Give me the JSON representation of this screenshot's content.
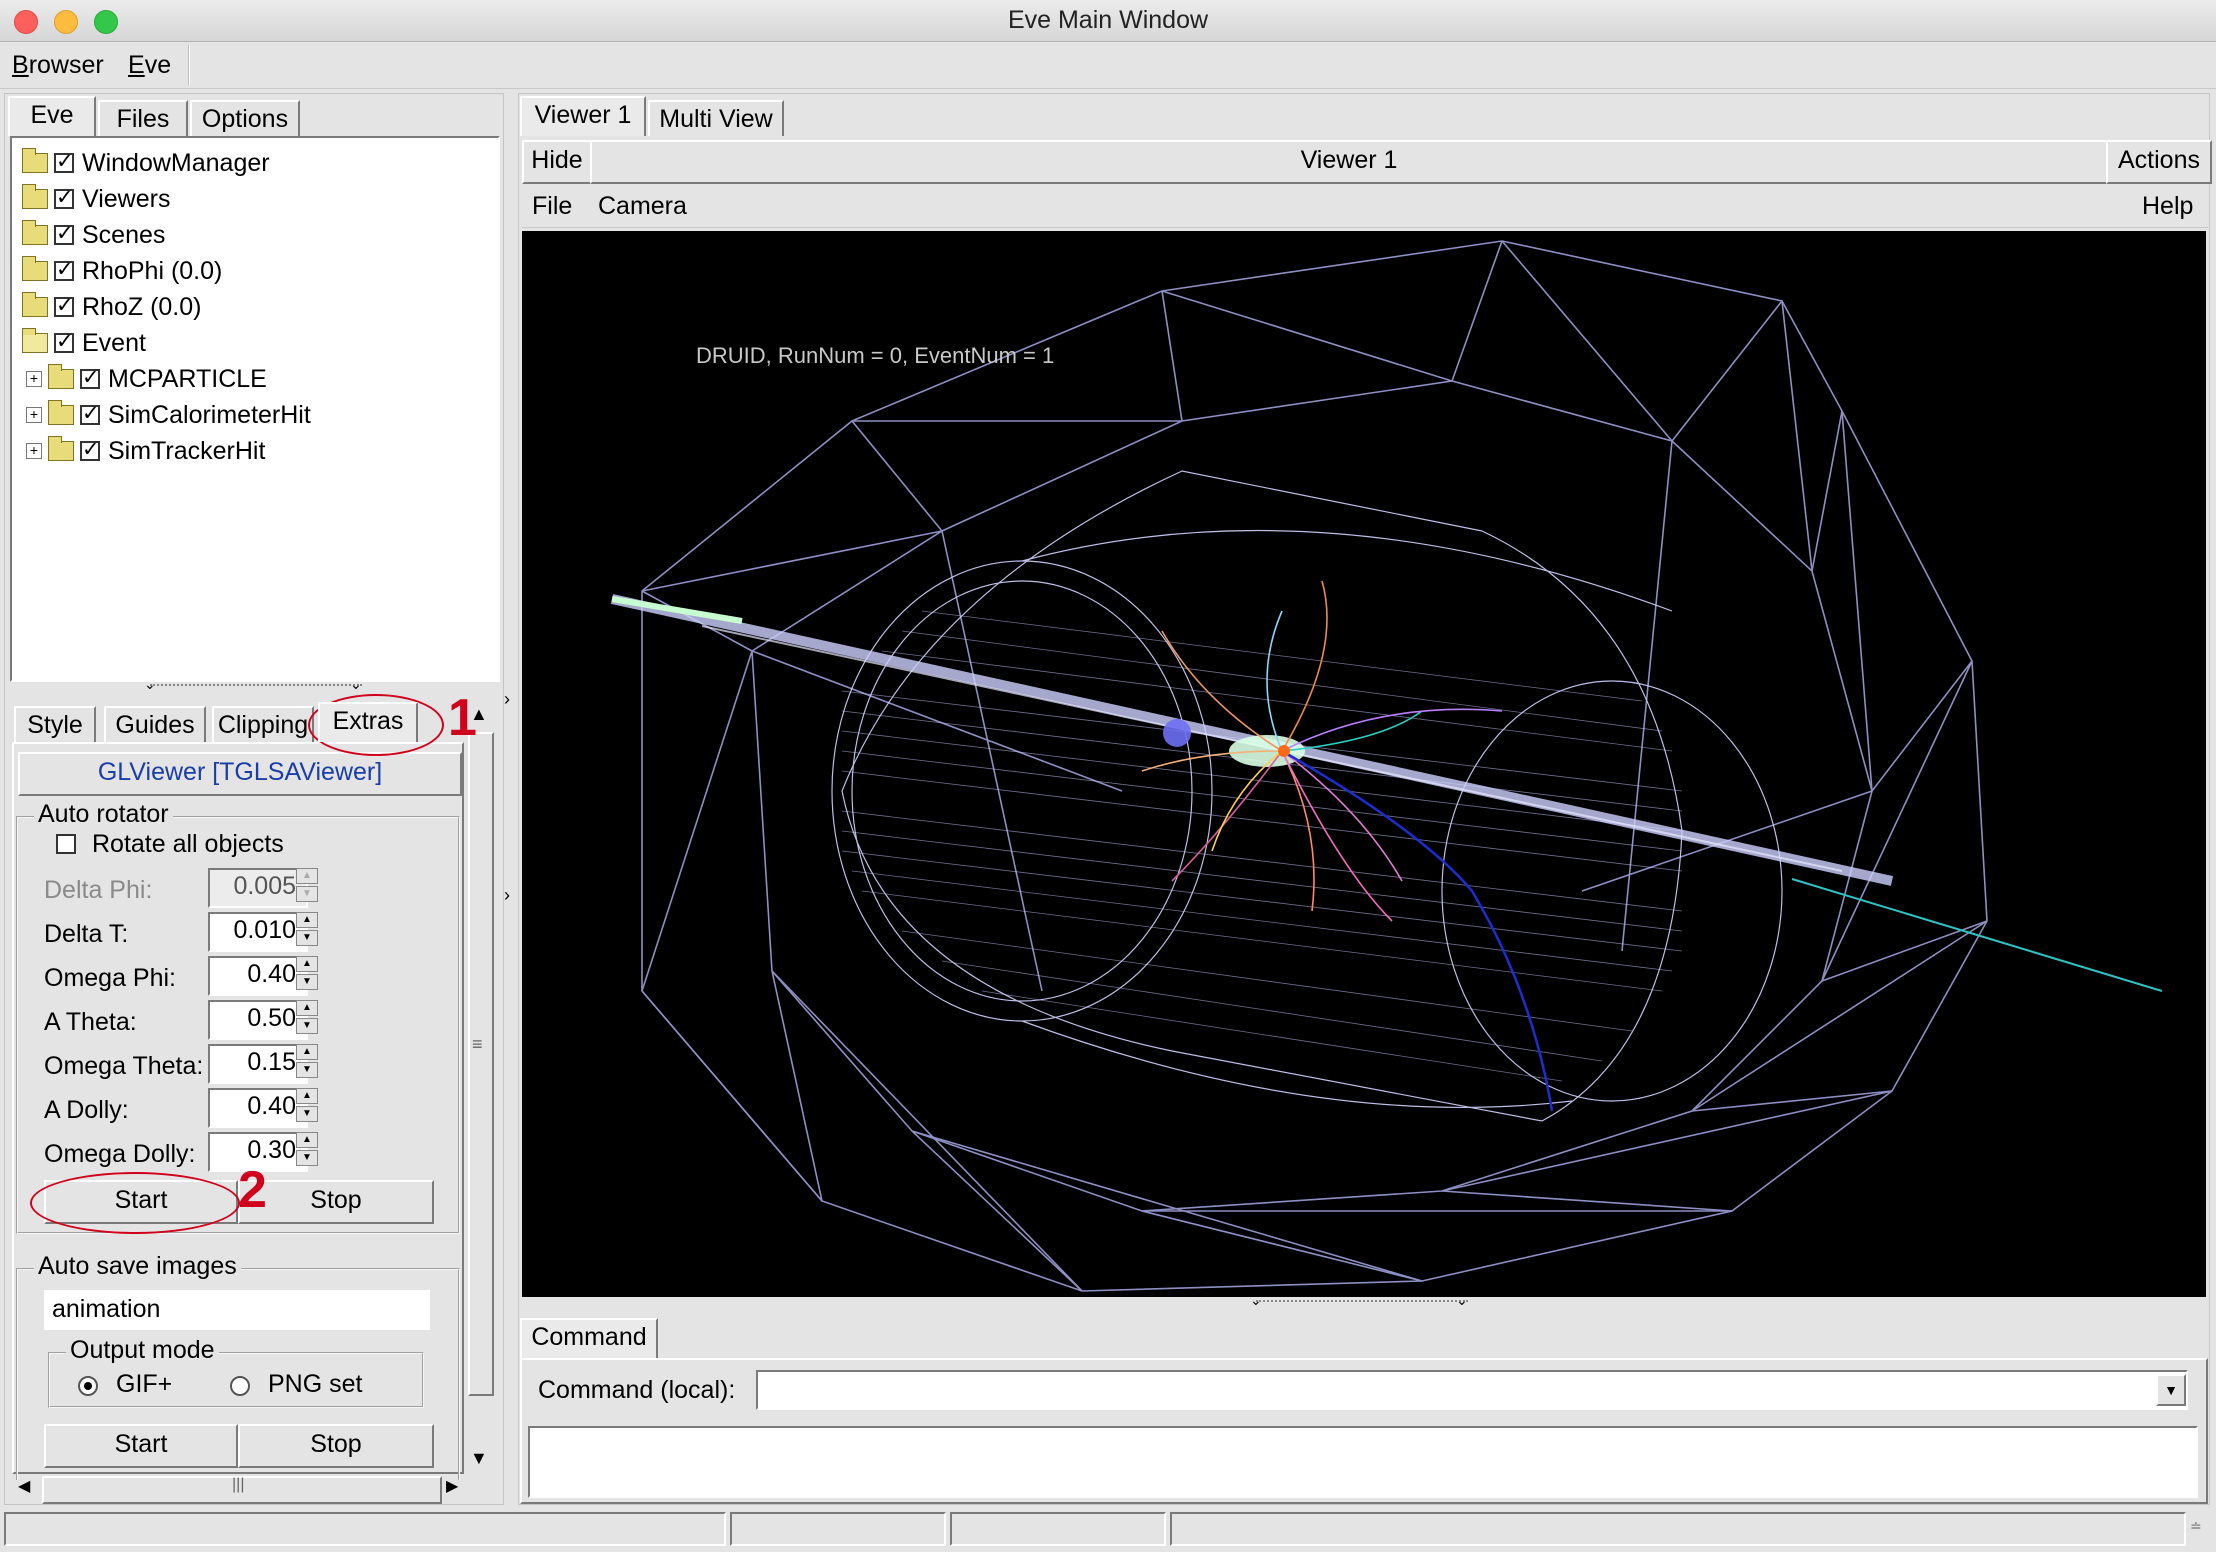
{
  "window": {
    "title": "Eve Main Window"
  },
  "menubar": {
    "items": [
      "Browser",
      "Eve"
    ]
  },
  "left_tabs": [
    "Eve",
    "Files",
    "Options"
  ],
  "tree": [
    {
      "label": "WindowManager",
      "checked": true,
      "expander": false,
      "open": false
    },
    {
      "label": "Viewers",
      "checked": true,
      "expander": false,
      "open": false
    },
    {
      "label": "Scenes",
      "checked": true,
      "expander": false,
      "open": false
    },
    {
      "label": "RhoPhi (0.0)",
      "checked": true,
      "expander": false,
      "open": false
    },
    {
      "label": "RhoZ (0.0)",
      "checked": true,
      "expander": false,
      "open": false
    },
    {
      "label": "Event",
      "checked": true,
      "expander": false,
      "open": true
    },
    {
      "label": "MCPARTICLE",
      "checked": true,
      "expander": true,
      "open": false
    },
    {
      "label": "SimCalorimeterHit",
      "checked": true,
      "expander": true,
      "open": false
    },
    {
      "label": "SimTrackerHit",
      "checked": true,
      "expander": true,
      "open": false
    }
  ],
  "editor_tabs": [
    "Style",
    "Guides",
    "Clipping",
    "Extras"
  ],
  "glviewer_label": "GLViewer [TGLSAViewer]",
  "auto_rotator": {
    "title": "Auto rotator",
    "rotate_all_label": "Rotate all objects",
    "rotate_all_checked": false,
    "params": [
      {
        "label": "Delta Phi:",
        "value": "0.005",
        "disabled": true
      },
      {
        "label": "Delta T:",
        "value": "0.010",
        "disabled": false
      },
      {
        "label": "Omega Phi:",
        "value": "0.40",
        "disabled": false
      },
      {
        "label": "A Theta:",
        "value": "0.50",
        "disabled": false
      },
      {
        "label": "Omega Theta:",
        "value": "0.15",
        "disabled": false
      },
      {
        "label": "A Dolly:",
        "value": "0.40",
        "disabled": false
      },
      {
        "label": "Omega Dolly:",
        "value": "0.30",
        "disabled": false
      }
    ],
    "start_label": "Start",
    "stop_label": "Stop"
  },
  "auto_save": {
    "title": "Auto save images",
    "filename": "animation",
    "output_mode_title": "Output mode",
    "modes": [
      "GIF+",
      "PNG set"
    ],
    "selected_mode": "GIF+",
    "start_label": "Start",
    "stop_label": "Stop"
  },
  "annotations": {
    "one": "1",
    "two": "2"
  },
  "viewer_tabs": [
    "Viewer 1",
    "Multi View"
  ],
  "viewer": {
    "hide_label": "Hide",
    "title": "Viewer 1",
    "actions_label": "Actions",
    "menu": [
      "File",
      "Camera"
    ],
    "help_label": "Help",
    "hud_text": "DRUID, RunNum = 0, EventNum = 1"
  },
  "command": {
    "tab_label": "Command",
    "label": "Command (local):",
    "value": ""
  },
  "colors": {
    "accent_red": "#d0021b",
    "glviewer_text": "#1a3ea8",
    "wire": "#a7a9e6"
  }
}
